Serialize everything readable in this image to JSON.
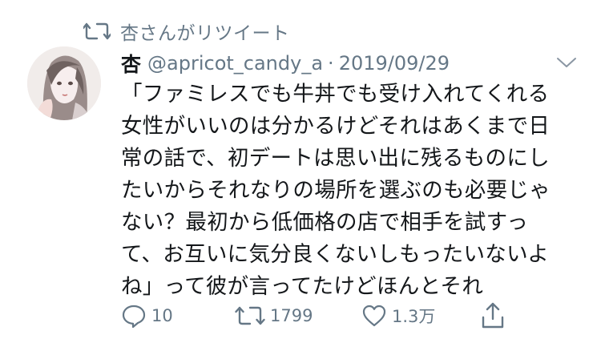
{
  "retweet_banner": {
    "text": "杏さんがリツイート"
  },
  "tweet": {
    "display_name": "杏",
    "handle": "@apricot_candy_a",
    "separator": "·",
    "date": "2019/09/29",
    "lines": [
      "「ファミレスでも牛丼でも受け入れてくれる",
      "女性がいいのは分かるけどそれはあくまで日",
      "常の話で、初デートは思い出に残るものにし",
      "たいからそれなりの場所を選ぶのも必要じゃ",
      "ない？最初から低価格の店で相手を試すっ",
      "て、お互いに気分良くないしもったいないよ",
      "ね」って彼が言ってたけどほんとそれ"
    ]
  },
  "actions": {
    "reply_count": "10",
    "retweet_count": "1799",
    "like_count": "1.3万"
  },
  "icons": {
    "retweet_banner": "retweet-icon",
    "more": "chevron-down-icon",
    "reply": "reply-icon",
    "retweet": "retweet-icon",
    "like": "heart-icon",
    "share": "share-icon"
  },
  "colors": {
    "text": "#14171a",
    "secondary": "#657786",
    "background": "#ffffff"
  }
}
